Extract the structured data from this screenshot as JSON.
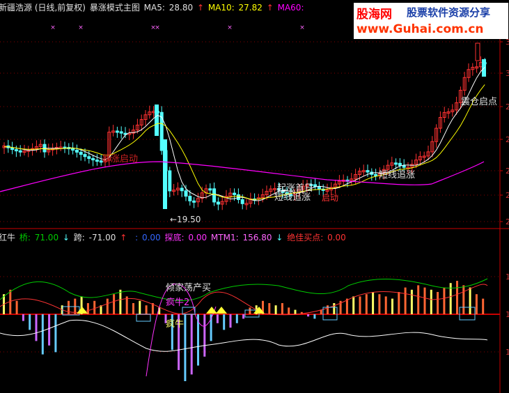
{
  "main_header": {
    "stock": "新疆浩源 (日线,前复权)",
    "formula": "暴涨模式主图",
    "ma5_label": "MA5:",
    "ma5_value": "28.80",
    "ma10_label": "MA10:",
    "ma10_value": "27.82",
    "ma60_label": "MA60:",
    "up_arrow": "↑"
  },
  "watermark": {
    "brand": "股海网",
    "tagline": "股票软件资源分享",
    "url": "www.Guhai.com.cn"
  },
  "sub_header": {
    "name": "红牛",
    "qiao_label": "桥:",
    "qiao_value": "71.00",
    "kua_label": "跨:",
    "kua_value": "-71.00",
    "blank_label": ":",
    "blank_value": "0.00",
    "tandi_label": "探底:",
    "tandi_value": "0.00",
    "mtm_label": "MTM1:",
    "mtm_value": "156.80",
    "best_label": "绝佳买点:",
    "best_value": "0.00",
    "down_arrow": "↓",
    "up_arrow": "↑"
  },
  "annotations": {
    "baozhang": "暴涨启动",
    "low_price": "←19.50",
    "qizhang": "起涨首日",
    "duanxian1": "短线追涨",
    "qidong": "启动",
    "duanxian2": "短线追涨",
    "zhencang": "震仓启点",
    "qingjia": "倾家荡产买",
    "fengniu1": "疯牛2",
    "fengniu2": "疯牛"
  },
  "colors": {
    "up": "#ff3232",
    "down": "#54ffff",
    "ma5": "#ffffff",
    "ma10": "#ffff00",
    "ma60": "#ff00ff",
    "hist_pos_red": "#ff6633",
    "hist_pos_yellow": "#ffff66",
    "hist_neg_cyan": "#66ccff",
    "hist_neg_violet": "#cc66ff",
    "line_green": "#00cc00",
    "line_red": "#ff3333",
    "line_white": "#ffffff",
    "line_purple": "#ff33ff",
    "grid": "#880000",
    "axis_red": "#cc0000"
  },
  "chart_data": [
    {
      "type": "candlestick",
      "title": "新疆浩源 (日线,前复权) 暴涨模式主图",
      "series": [
        {
          "name": "MA5"
        },
        {
          "name": "MA10"
        },
        {
          "name": "MA60"
        }
      ],
      "y_ticks": [
        "3",
        "3",
        "2",
        "2",
        "2",
        "2",
        "2"
      ],
      "annotated_low": 19.5
    },
    {
      "type": "bar",
      "title": "红牛",
      "values": [
        9,
        11,
        6,
        -3,
        -7,
        -12,
        -18,
        -14,
        -17,
        4,
        6,
        7,
        8,
        5,
        6,
        4,
        7,
        9,
        11,
        8,
        5,
        6,
        4,
        5,
        3,
        -4,
        -16,
        -25,
        -30,
        -27,
        -23,
        -19,
        -12,
        -4,
        -7,
        -6,
        -4,
        -2,
        3,
        4,
        6,
        5,
        4,
        5,
        3,
        2,
        1,
        -1,
        -2,
        2,
        4,
        5,
        6,
        7,
        8,
        8,
        9,
        10,
        9,
        8,
        7,
        10,
        12,
        11,
        13,
        12,
        11,
        10,
        12,
        14,
        15,
        13,
        12,
        9,
        7
      ]
    }
  ]
}
